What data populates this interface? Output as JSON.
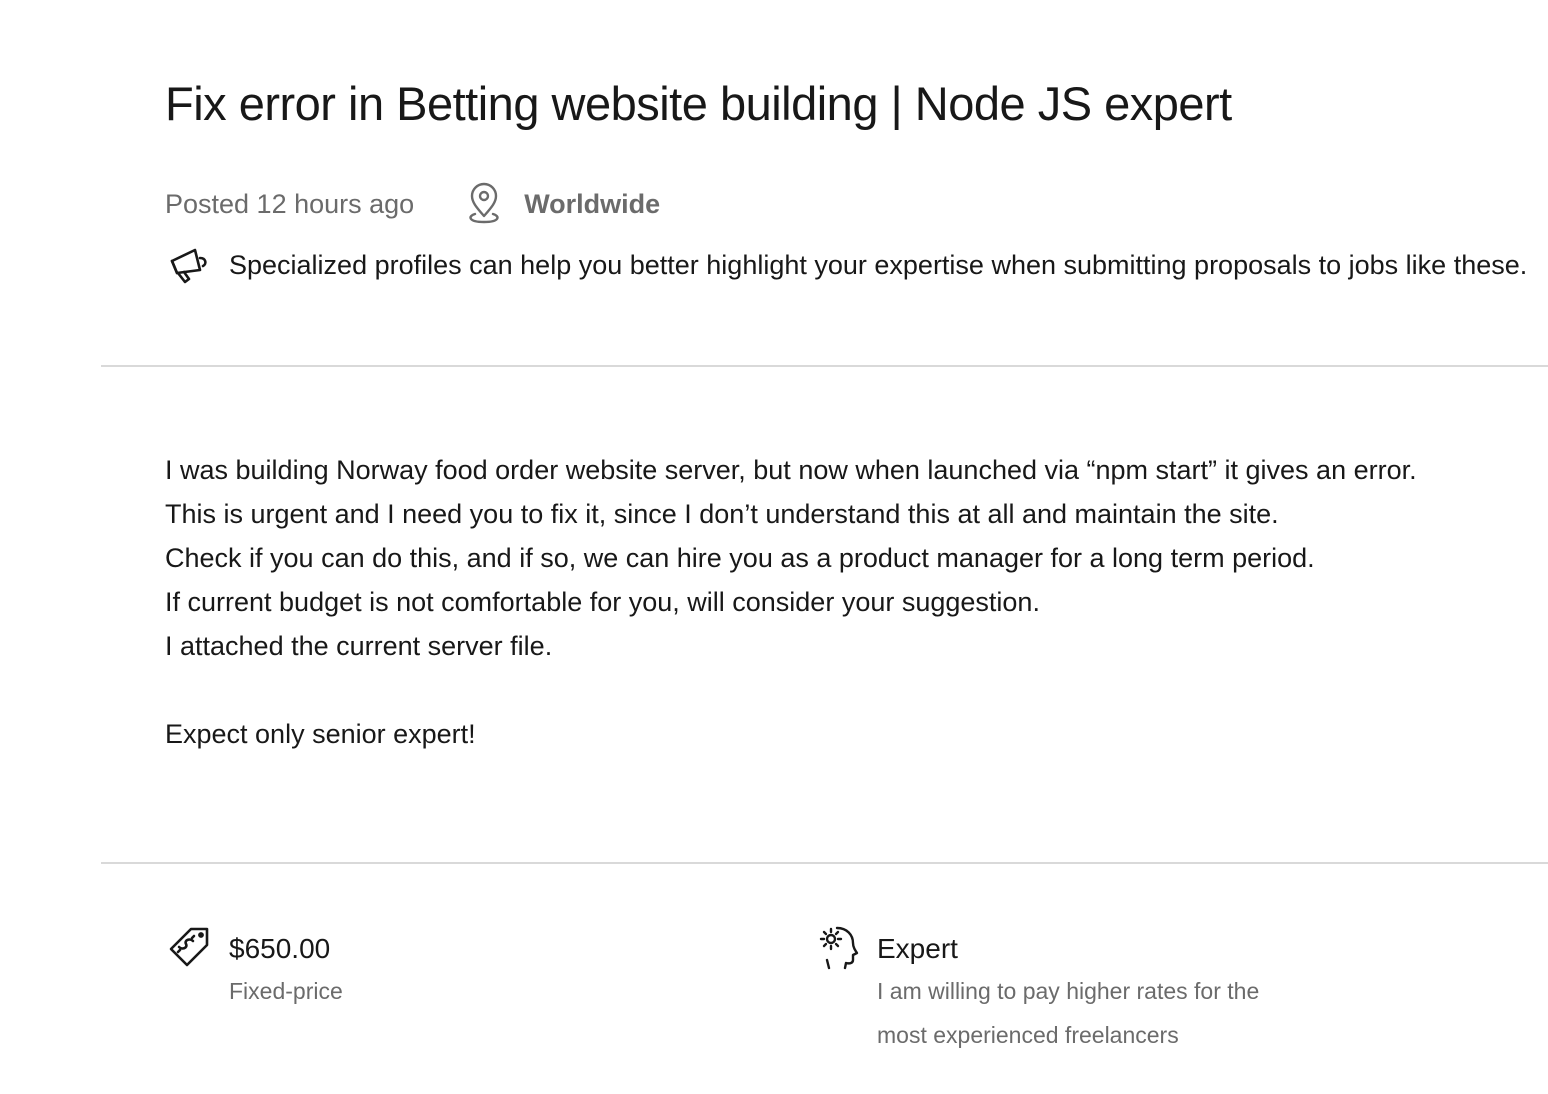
{
  "job": {
    "title": "Fix error in Betting website building | Node JS expert",
    "posted": "Posted 12 hours ago",
    "location": "Worldwide",
    "notice": "Specialized profiles can help you better highlight your expertise when submitting proposals to jobs like these."
  },
  "description": {
    "lines": [
      "I was building Norway food order website server, but now when launched via “npm start” it gives an error.",
      "This is urgent and I need you to fix it, since I don’t understand this at all and maintain the site.",
      "Check if you can do this, and if so, we can hire you as a product manager for a long term period.",
      "If current budget is not comfortable for you, will consider your suggestion.",
      "I attached the current server file.",
      "Expect only senior expert!"
    ]
  },
  "details": {
    "price": {
      "value": "$650.00",
      "label": "Fixed-price",
      "icon": "price-tag-icon"
    },
    "level": {
      "value": "Expert",
      "label": "I am willing to pay higher rates for the most experienced freelancers",
      "icon": "expert-head-gear-icon"
    }
  },
  "icons": {
    "location": "location-pin-icon",
    "notice": "megaphone-icon"
  },
  "colors": {
    "text_primary": "#181818",
    "text_muted": "#6b6b6b",
    "divider": "#d9d9d9"
  }
}
